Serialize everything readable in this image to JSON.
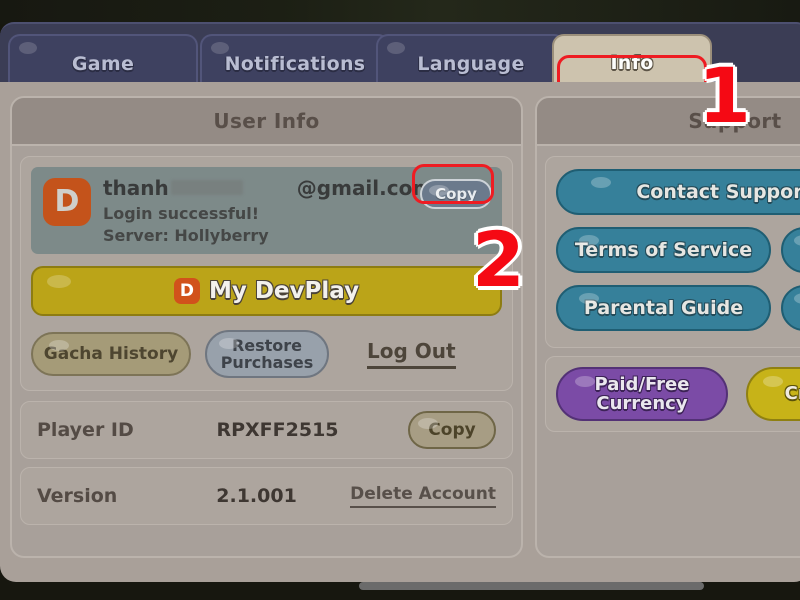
{
  "tabs": [
    {
      "label": "Game",
      "active": false
    },
    {
      "label": "Notifications",
      "active": false
    },
    {
      "label": "Language",
      "active": false
    },
    {
      "label": "Info",
      "active": true
    }
  ],
  "user_panel": {
    "title": "User Info",
    "account": {
      "avatar_letter": "D",
      "name": "thanh",
      "email_domain": "@gmail.com",
      "status": "Login successful!",
      "server": "Server: Hollyberry",
      "copy_label": "Copy"
    },
    "devplay_button": {
      "icon_letter": "D",
      "label": "My DevPlay"
    },
    "gacha_history_label": "Gacha History",
    "restore_purchases_label": "Restore\nPurchases",
    "restore_purchases_line1": "Restore",
    "restore_purchases_line2": "Purchases",
    "logout_label": "Log Out",
    "player_id": {
      "label": "Player ID",
      "value": "RPXFF2515",
      "copy_label": "Copy"
    },
    "version": {
      "label": "Version",
      "value": "2.1.001",
      "delete_label": "Delete Account"
    }
  },
  "support_panel": {
    "title": "Support",
    "contact_support_label": "Contact Support",
    "terms_label": "Terms of Service",
    "parental_label": "Parental Guide",
    "paid_free_line1": "Paid/Free",
    "paid_free_line2": "Currency",
    "credits_label": "Credits"
  },
  "markers": [
    {
      "number": "1"
    },
    {
      "number": "2"
    }
  ],
  "colors": {
    "accent_red": "#ee1c22",
    "tab_active_bg": "#cdc3ae",
    "panel_bg": "#a9a099",
    "devplay_yellow": "#bba418",
    "support_blue": "#36809a",
    "purple": "#7b4ba6"
  }
}
